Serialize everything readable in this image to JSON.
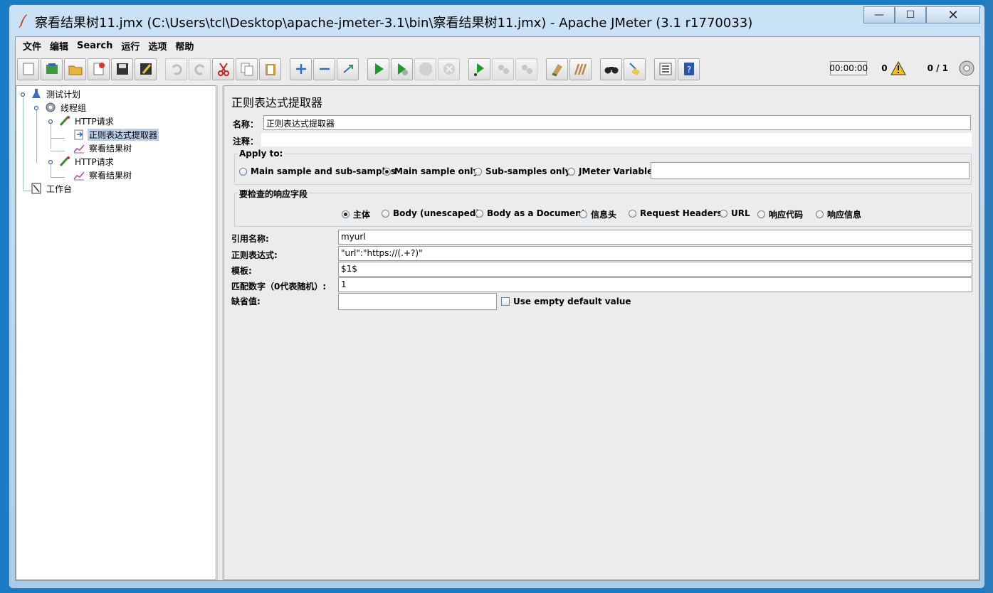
{
  "window": {
    "title": "察看结果树11.jmx (C:\\Users\\tcl\\Desktop\\apache-jmeter-3.1\\bin\\察看结果树11.jmx) - Apache JMeter (3.1 r1770033)",
    "minimize": "—",
    "maximize": "☐",
    "close": "✕"
  },
  "menu": {
    "items": [
      "文件",
      "编辑",
      "Search",
      "运行",
      "选项",
      "帮助"
    ]
  },
  "toolbar_status": {
    "timer": "00:00:00",
    "error_count": "0",
    "threads": "0 / 1"
  },
  "tree": {
    "nodes": [
      {
        "label": "测试计划",
        "icon": "test-plan-icon"
      },
      {
        "label": "线程组",
        "icon": "thread-group-icon"
      },
      {
        "label": "HTTP请求",
        "icon": "http-sampler-icon"
      },
      {
        "label": "正则表达式提取器",
        "icon": "regex-extractor-icon"
      },
      {
        "label": "察看结果树",
        "icon": "results-tree-icon"
      },
      {
        "label": "HTTP请求",
        "icon": "http-sampler-icon"
      },
      {
        "label": "察看结果树",
        "icon": "results-tree-icon"
      },
      {
        "label": "工作台",
        "icon": "workbench-icon"
      }
    ]
  },
  "panel": {
    "title": "正则表达式提取器",
    "name_label": "名称：",
    "name_value": "正则表达式提取器",
    "comment_label": "注释：",
    "apply_to": {
      "title": "Apply to:",
      "options": [
        "Main sample and sub-samples",
        "Main sample only",
        "Sub-samples only",
        "JMeter Variable"
      ],
      "selected": "Main sample only",
      "variable_value": ""
    },
    "field_to_check": {
      "title": "要检查的响应字段",
      "options": [
        "主体",
        "Body (unescaped)",
        "Body as a Document",
        "信息头",
        "Request Headers",
        "URL",
        "响应代码",
        "响应信息"
      ],
      "selected": "主体"
    },
    "ref_name_label": "引用名称:",
    "ref_name_value": "myurl",
    "regex_label": "正则表达式:",
    "regex_value": "\"url\":\"https://(.+?)\"",
    "template_label": "模板:",
    "template_value": "$1$",
    "match_no_label": "匹配数字（0代表随机）:",
    "match_no_value": "1",
    "default_label": "缺省值:",
    "default_value": "",
    "use_empty_label": "Use empty default value",
    "use_empty_checked": false
  }
}
